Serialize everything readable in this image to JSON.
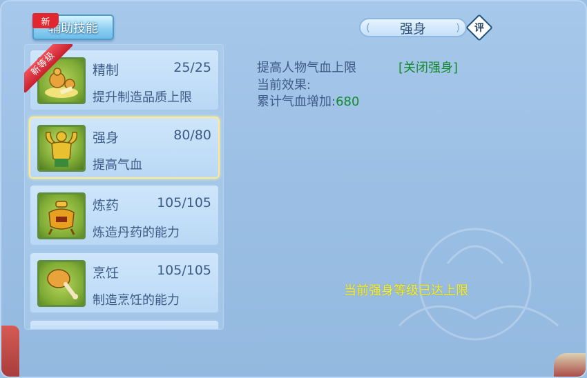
{
  "tab": {
    "label": "辅助技能",
    "new_badge": "新"
  },
  "ribbon_label": "新等级",
  "skills": [
    {
      "name": "精制",
      "level": "25/25",
      "desc": "提升制造品质上限",
      "icon": "refine-icon"
    },
    {
      "name": "强身",
      "level": "80/80",
      "desc": "提高气血",
      "icon": "strength-icon"
    },
    {
      "name": "炼药",
      "level": "105/105",
      "desc": "炼造丹药的能力",
      "icon": "alchemy-icon"
    },
    {
      "name": "烹饪",
      "level": "105/105",
      "desc": "制造烹饪的能力",
      "icon": "cooking-icon"
    }
  ],
  "detail": {
    "title": "强身",
    "rate_label": "评",
    "line1": "提高人物气血上限",
    "toggle_label": "[关闭强身]",
    "line2": "当前效果:",
    "line3_label": "累计气血增加:",
    "line3_value": "680",
    "max_message": "当前强身等级已达上限"
  },
  "colors": {
    "accent_green": "#128a2c",
    "max_yellow": "#f3ee3a",
    "text_blue": "#3c5a86"
  }
}
